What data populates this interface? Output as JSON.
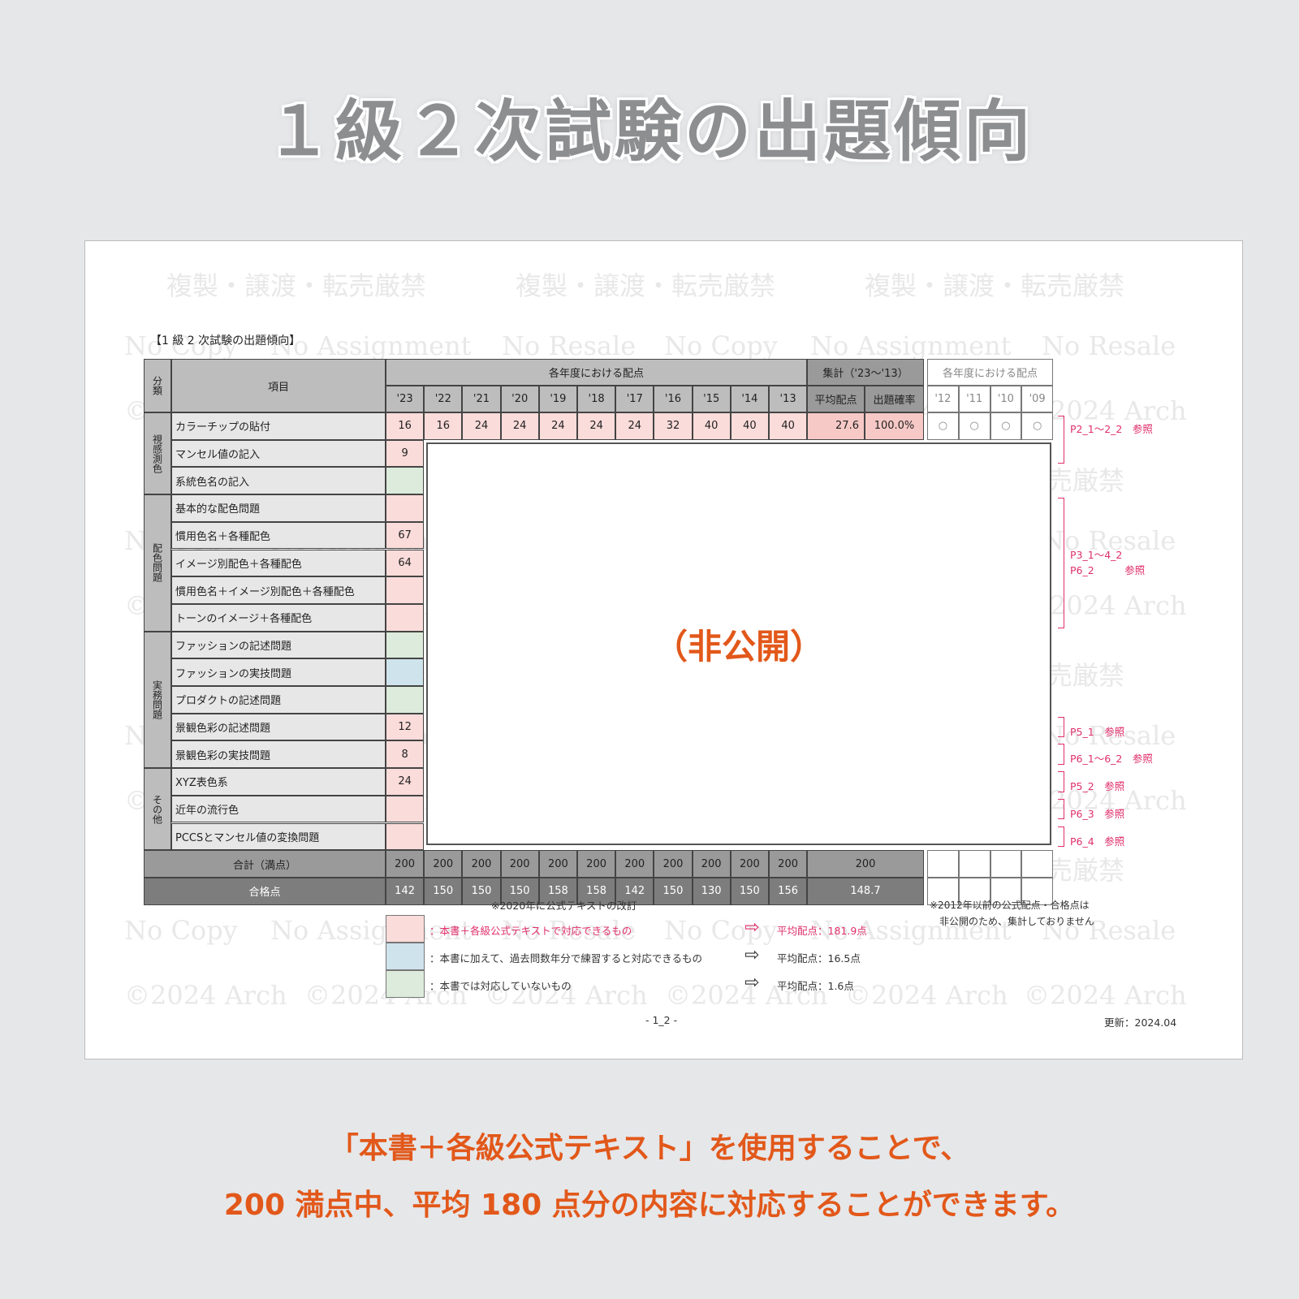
{
  "title": "１級２次試験の出題傾向",
  "watermarks": [
    "複製・譲渡・転売厳禁",
    "No Copy",
    "No Assignment",
    "No Resale",
    "©2024 Arch"
  ],
  "doc": {
    "heading": "【1 級 2 次試験の出題傾向】",
    "headers": {
      "category": "分類",
      "item": "項目",
      "years_group": "各年度における配点",
      "summary_group": "集計（'23〜'13）",
      "avg": "平均配点",
      "rate": "出題確率",
      "old_group": "各年度における配点"
    },
    "years": [
      "'23",
      "'22",
      "'21",
      "'20",
      "'19",
      "'18",
      "'17",
      "'16",
      "'15",
      "'14",
      "'13"
    ],
    "old_years": [
      "'12",
      "'11",
      "'10",
      "'09"
    ],
    "categories": [
      {
        "label": "視感測色",
        "rows": 3
      },
      {
        "label": "配色問題",
        "rows": 5
      },
      {
        "label": "実務問題",
        "rows": 5
      },
      {
        "label": "その他",
        "rows": 3
      }
    ],
    "rows": [
      {
        "item": "カラーチップの貼付",
        "color": "pink",
        "values": [
          "16",
          "16",
          "24",
          "24",
          "24",
          "24",
          "24",
          "32",
          "40",
          "40",
          "40"
        ],
        "avg": "27.6",
        "rate": "100.0%",
        "old": [
          "○",
          "○",
          "○",
          "○"
        ]
      },
      {
        "item": "マンセル値の記入",
        "color": "pink",
        "values": [
          "9"
        ]
      },
      {
        "item": "系統色名の記入",
        "color": "green",
        "values": [
          ""
        ]
      },
      {
        "item": "基本的な配色問題",
        "color": "pink",
        "values": [
          ""
        ]
      },
      {
        "item": "慣用色名＋各種配色",
        "color": "pink",
        "values": [
          "67"
        ]
      },
      {
        "item": "イメージ別配色＋各種配色",
        "color": "pink",
        "values": [
          "64"
        ]
      },
      {
        "item": "慣用色名＋イメージ別配色＋各種配色",
        "color": "pink",
        "values": [
          ""
        ]
      },
      {
        "item": "トーンのイメージ＋各種配色",
        "color": "pink",
        "values": [
          ""
        ]
      },
      {
        "item": "ファッションの記述問題",
        "color": "green",
        "values": [
          ""
        ]
      },
      {
        "item": "ファッションの実技問題",
        "color": "blue",
        "values": [
          ""
        ]
      },
      {
        "item": "プロダクトの記述問題",
        "color": "green",
        "values": [
          ""
        ]
      },
      {
        "item": "景観色彩の記述問題",
        "color": "pink",
        "values": [
          "12"
        ]
      },
      {
        "item": "景観色彩の実技問題",
        "color": "pink",
        "values": [
          "8"
        ]
      },
      {
        "item": "XYZ表色系",
        "color": "pink",
        "values": [
          "24"
        ]
      },
      {
        "item": "近年の流行色",
        "color": "pink",
        "values": [
          ""
        ]
      },
      {
        "item": "PCCSとマンセル値の変換問題",
        "color": "pink",
        "values": [
          ""
        ]
      }
    ],
    "total": {
      "label": "合計（満点）",
      "values": [
        "200",
        "200",
        "200",
        "200",
        "200",
        "200",
        "200",
        "200",
        "200",
        "200",
        "200"
      ],
      "summary": "200"
    },
    "pass": {
      "label": "合格点",
      "values": [
        "142",
        "150",
        "150",
        "150",
        "158",
        "158",
        "142",
        "150",
        "130",
        "150",
        "156"
      ],
      "summary": "148.7"
    },
    "hidden_label": "（非公開）",
    "refs": [
      {
        "text": "P2_1〜2_2　参照",
        "from": 0,
        "to": 1
      },
      {
        "text": "P3_1〜4_2\nP6_2　　　参照",
        "from": 3,
        "to": 7
      },
      {
        "text": "P5_1　参照",
        "from": 11,
        "to": 11
      },
      {
        "text": "P6_1〜6_2　参照",
        "from": 12,
        "to": 12
      },
      {
        "text": "P5_2　参照",
        "from": 13,
        "to": 13
      },
      {
        "text": "P6_3　参照",
        "from": 14,
        "to": 14
      },
      {
        "text": "P6_4　参照",
        "from": 15,
        "to": 15
      }
    ],
    "note_revision": "※2020年に公式テキストの改訂",
    "note_old": "※2012年以前の公式配点・合格点は\n　非公開のため、集計しておりません",
    "legend": [
      {
        "color": "#fadcda",
        "text": "：本書＋各級公式テキストで対応できるもの",
        "avg": "平均配点：181.9点",
        "accent": "#e0306a"
      },
      {
        "color": "#cfe3ec",
        "text": "：本書に加えて、過去問数年分で練習すると対応できるもの",
        "avg": "平均配点：16.5点",
        "accent": "#333333"
      },
      {
        "color": "#dcebdc",
        "text": "：本書では対応していないもの",
        "avg": "平均配点：1.6点",
        "accent": "#333333"
      }
    ],
    "page_number": "- 1_2 -",
    "updated": "更新：2024.04"
  },
  "footer": {
    "line1": "「本書＋各級公式テキスト」を使用することで、",
    "line2": "200 満点中、平均 180 点分の内容に対応することができます。"
  }
}
